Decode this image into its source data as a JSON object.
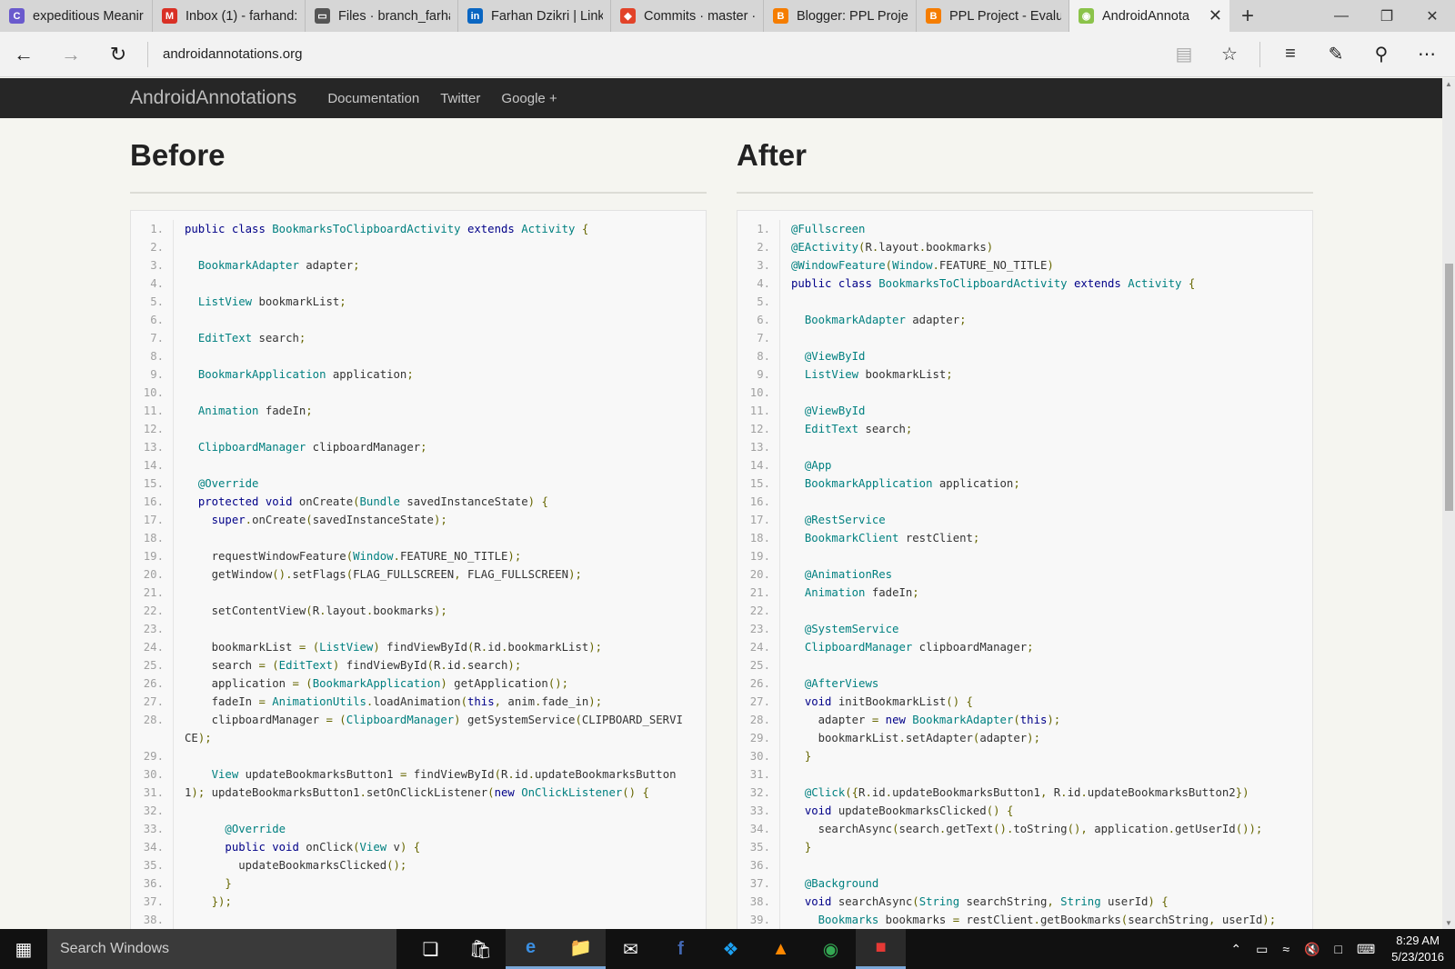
{
  "browser": {
    "tabs": [
      {
        "label": "expeditious Meanir",
        "icon": "copyscape-icon",
        "color": "#6a5acd"
      },
      {
        "label": "Inbox (1) - farhand:",
        "icon": "gmail-icon",
        "color": "#d93025"
      },
      {
        "label": "Files · branch_farha",
        "icon": "page-icon",
        "color": "#555555"
      },
      {
        "label": "Farhan Dzikri | Link",
        "icon": "linkedin-icon",
        "color": "#0a66c2"
      },
      {
        "label": "Commits · master ·",
        "icon": "gitlab-icon",
        "color": "#e24329"
      },
      {
        "label": "Blogger: PPL Projec",
        "icon": "blogger-icon",
        "color": "#f57d00"
      },
      {
        "label": "PPL Project - Evalua",
        "icon": "blogger-icon",
        "color": "#f57d00"
      },
      {
        "label": "AndroidAnnota",
        "icon": "androidannotations-icon",
        "color": "#8bc34a",
        "active": true
      }
    ],
    "url": "androidannotations.org"
  },
  "site": {
    "brand": "AndroidAnnotations",
    "nav": [
      "Documentation",
      "Twitter",
      "Google +"
    ]
  },
  "before": {
    "title": "Before",
    "lines": [
      {
        "n": "1.",
        "t": "public class BookmarksToClipboardActivity extends Activity {"
      },
      {
        "n": "2.",
        "t": ""
      },
      {
        "n": "3.",
        "t": "  BookmarkAdapter adapter;"
      },
      {
        "n": "4.",
        "t": ""
      },
      {
        "n": "5.",
        "t": "  ListView bookmarkList;"
      },
      {
        "n": "6.",
        "t": ""
      },
      {
        "n": "7.",
        "t": "  EditText search;"
      },
      {
        "n": "8.",
        "t": ""
      },
      {
        "n": "9.",
        "t": "  BookmarkApplication application;"
      },
      {
        "n": "10.",
        "t": ""
      },
      {
        "n": "11.",
        "t": "  Animation fadeIn;"
      },
      {
        "n": "12.",
        "t": ""
      },
      {
        "n": "13.",
        "t": "  ClipboardManager clipboardManager;"
      },
      {
        "n": "14.",
        "t": ""
      },
      {
        "n": "15.",
        "t": "  @Override"
      },
      {
        "n": "16.",
        "t": "  protected void onCreate(Bundle savedInstanceState) {"
      },
      {
        "n": "17.",
        "t": "    super.onCreate(savedInstanceState);"
      },
      {
        "n": "18.",
        "t": ""
      },
      {
        "n": "19.",
        "t": "    requestWindowFeature(Window.FEATURE_NO_TITLE);"
      },
      {
        "n": "20.",
        "t": "    getWindow().setFlags(FLAG_FULLSCREEN, FLAG_FULLSCREEN);"
      },
      {
        "n": "21.",
        "t": ""
      },
      {
        "n": "22.",
        "t": "    setContentView(R.layout.bookmarks);"
      },
      {
        "n": "23.",
        "t": ""
      },
      {
        "n": "24.",
        "t": "    bookmarkList = (ListView) findViewById(R.id.bookmarkList);"
      },
      {
        "n": "25.",
        "t": "    search = (EditText) findViewById(R.id.search);"
      },
      {
        "n": "26.",
        "t": "    application = (BookmarkApplication) getApplication();"
      },
      {
        "n": "27.",
        "t": "    fadeIn = AnimationUtils.loadAnimation(this, anim.fade_in);"
      },
      {
        "n": "28.",
        "t": "    clipboardManager = (ClipboardManager) getSystemService(CLIPBOARD_SERVIC\nE);",
        "wrap": true
      },
      {
        "n": "29.",
        "t": ""
      },
      {
        "n": "30.",
        "t": "    View updateBookmarksButton1 = findViewById(R.id.updateBookmarksButton1);"
      },
      {
        "n": "31.",
        "t": "    updateBookmarksButton1.setOnClickListener(new OnClickListener() {"
      },
      {
        "n": "32.",
        "t": ""
      },
      {
        "n": "33.",
        "t": "      @Override"
      },
      {
        "n": "34.",
        "t": "      public void onClick(View v) {"
      },
      {
        "n": "35.",
        "t": "        updateBookmarksClicked();"
      },
      {
        "n": "36.",
        "t": "      }"
      },
      {
        "n": "37.",
        "t": "    });"
      },
      {
        "n": "38.",
        "t": ""
      }
    ]
  },
  "after": {
    "title": "After",
    "lines": [
      {
        "n": "1.",
        "t": "@Fullscreen"
      },
      {
        "n": "2.",
        "t": "@EActivity(R.layout.bookmarks)"
      },
      {
        "n": "3.",
        "t": "@WindowFeature(Window.FEATURE_NO_TITLE)"
      },
      {
        "n": "4.",
        "t": "public class BookmarksToClipboardActivity extends Activity {"
      },
      {
        "n": "5.",
        "t": ""
      },
      {
        "n": "6.",
        "t": "  BookmarkAdapter adapter;"
      },
      {
        "n": "7.",
        "t": ""
      },
      {
        "n": "8.",
        "t": "  @ViewById"
      },
      {
        "n": "9.",
        "t": "  ListView bookmarkList;"
      },
      {
        "n": "10.",
        "t": ""
      },
      {
        "n": "11.",
        "t": "  @ViewById"
      },
      {
        "n": "12.",
        "t": "  EditText search;"
      },
      {
        "n": "13.",
        "t": ""
      },
      {
        "n": "14.",
        "t": "  @App"
      },
      {
        "n": "15.",
        "t": "  BookmarkApplication application;"
      },
      {
        "n": "16.",
        "t": ""
      },
      {
        "n": "17.",
        "t": "  @RestService"
      },
      {
        "n": "18.",
        "t": "  BookmarkClient restClient;"
      },
      {
        "n": "19.",
        "t": ""
      },
      {
        "n": "20.",
        "t": "  @AnimationRes"
      },
      {
        "n": "21.",
        "t": "  Animation fadeIn;"
      },
      {
        "n": "22.",
        "t": ""
      },
      {
        "n": "23.",
        "t": "  @SystemService"
      },
      {
        "n": "24.",
        "t": "  ClipboardManager clipboardManager;"
      },
      {
        "n": "25.",
        "t": ""
      },
      {
        "n": "26.",
        "t": "  @AfterViews"
      },
      {
        "n": "27.",
        "t": "  void initBookmarkList() {"
      },
      {
        "n": "28.",
        "t": "    adapter = new BookmarkAdapter(this);"
      },
      {
        "n": "29.",
        "t": "    bookmarkList.setAdapter(adapter);"
      },
      {
        "n": "30.",
        "t": "  }"
      },
      {
        "n": "31.",
        "t": ""
      },
      {
        "n": "32.",
        "t": "  @Click({R.id.updateBookmarksButton1, R.id.updateBookmarksButton2})"
      },
      {
        "n": "33.",
        "t": "  void updateBookmarksClicked() {"
      },
      {
        "n": "34.",
        "t": "    searchAsync(search.getText().toString(), application.getUserId());"
      },
      {
        "n": "35.",
        "t": "  }"
      },
      {
        "n": "36.",
        "t": ""
      },
      {
        "n": "37.",
        "t": "  @Background"
      },
      {
        "n": "38.",
        "t": "  void searchAsync(String searchString, String userId) {"
      },
      {
        "n": "39.",
        "t": "    Bookmarks bookmarks = restClient.getBookmarks(searchString, userId);"
      }
    ]
  },
  "taskbar": {
    "search_placeholder": "Search Windows",
    "time": "8:29 AM",
    "date": "5/23/2016"
  },
  "colors": {
    "keyword": "#000088",
    "type": "#008080",
    "annotation": "#008080",
    "punct": "#666600",
    "plain": "#333333"
  }
}
